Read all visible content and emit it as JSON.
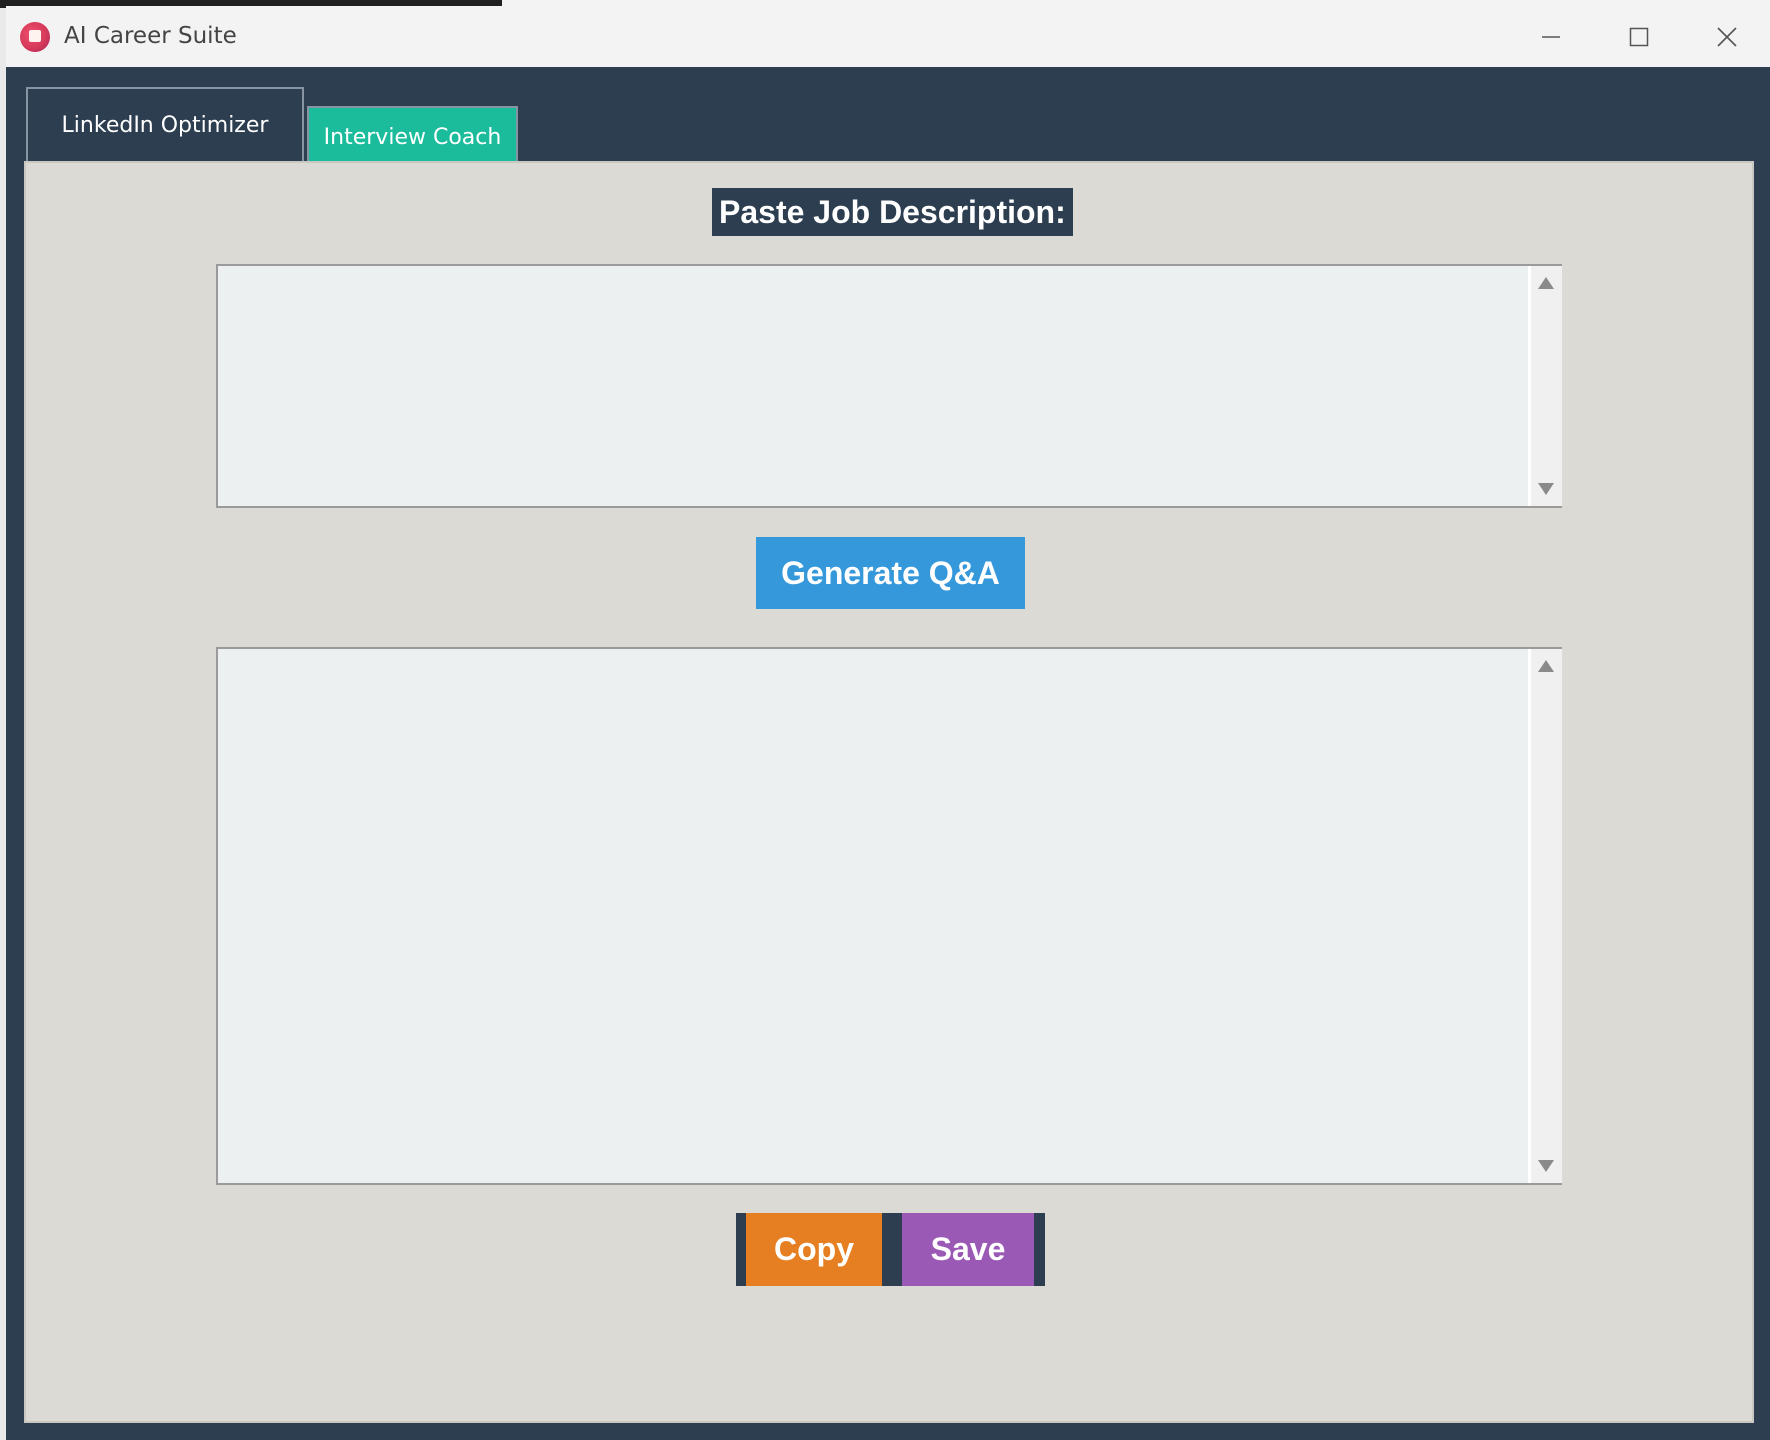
{
  "window": {
    "title": "AI Career Suite",
    "controls": {
      "minimize_icon": "minimize-icon",
      "maximize_icon": "maximize-icon",
      "close_icon": "close-icon"
    }
  },
  "tabs": [
    {
      "label": "LinkedIn Optimizer",
      "active": false
    },
    {
      "label": "Interview Coach",
      "active": true
    }
  ],
  "interview_coach": {
    "prompt_label": "Paste Job Description:",
    "job_description_value": "",
    "generate_label": "Generate Q&A",
    "output_value": "",
    "copy_label": "Copy",
    "save_label": "Save"
  },
  "colors": {
    "window_bg": "#2c3e50",
    "panel_bg": "#dcdad5",
    "textbox_bg": "#ecf0f1",
    "active_tab": "#1abc9c",
    "generate_button": "#3498db",
    "copy_button": "#e67e22",
    "save_button": "#9b59b6"
  }
}
